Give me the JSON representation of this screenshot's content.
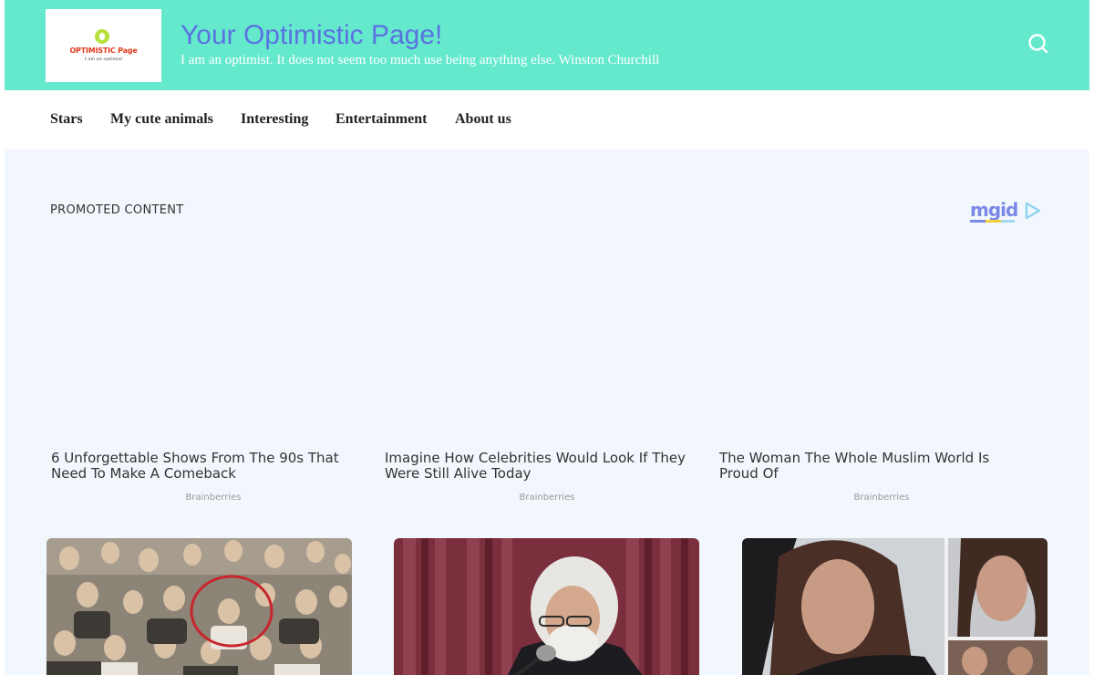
{
  "site": {
    "title": "Your Optimistic Page!",
    "tagline": "I am an optimist. It does not seem too much use being anything else. Winston Churchill",
    "logo_text": "OPTIMISTIC Page",
    "logo_subtext": "I am an optimist",
    "icon_search": "search-icon"
  },
  "nav": {
    "items": [
      {
        "label": "Stars"
      },
      {
        "label": "My cute animals"
      },
      {
        "label": "Interesting"
      },
      {
        "label": "Entertainment"
      },
      {
        "label": "About us"
      }
    ]
  },
  "promoted": {
    "label": "PROMOTED CONTENT",
    "brand": "mgid",
    "cards": [
      {
        "title": "6 Unforgettable Shows From The 90s That Need To Make A Comeback",
        "source": "Brainberries"
      },
      {
        "title": "Imagine How Celebrities Would Look If They Were Still Alive Today",
        "source": "Brainberries"
      },
      {
        "title": "The Woman The Whole Muslim World Is Proud Of",
        "source": "Brainberries"
      }
    ]
  },
  "colors": {
    "header_bg": "#64e9cd",
    "title_color": "#5b72e0",
    "page_bg": "#f1f7fc",
    "mgid_blue": "#7a89e6"
  }
}
